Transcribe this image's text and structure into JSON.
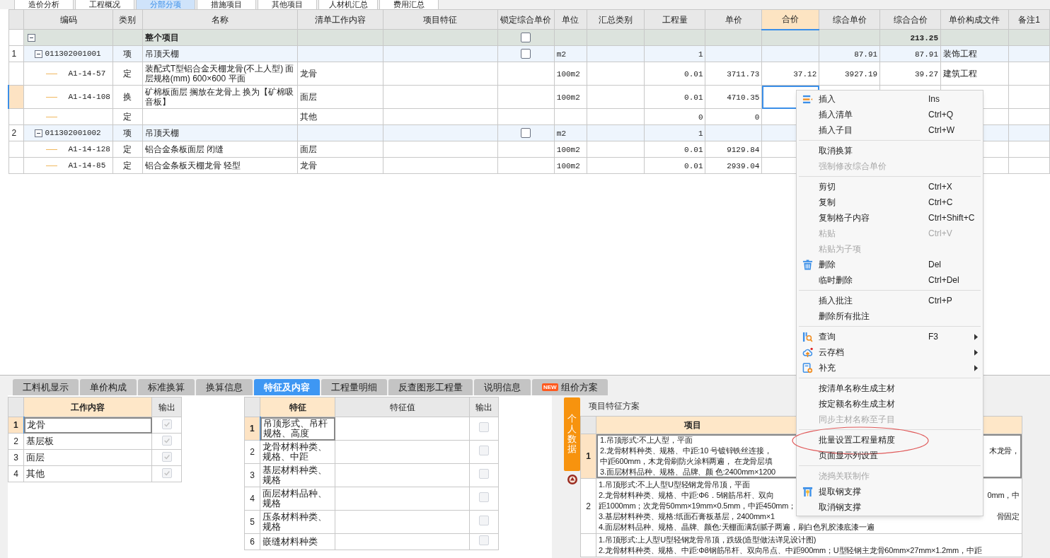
{
  "top_tabs": [
    {
      "label": "造价分析",
      "selected": false
    },
    {
      "label": "工程概况",
      "selected": false
    },
    {
      "label": "分部分项",
      "selected": true
    },
    {
      "label": "措施项目",
      "selected": false
    },
    {
      "label": "其他项目",
      "selected": false
    },
    {
      "label": "人材机汇总",
      "selected": false
    },
    {
      "label": "费用汇总",
      "selected": false
    }
  ],
  "main_table": {
    "columns": [
      {
        "label": "编码",
        "selected": false
      },
      {
        "label": "类别",
        "selected": false
      },
      {
        "label": "名称",
        "selected": false
      },
      {
        "label": "清单工作内容",
        "selected": false
      },
      {
        "label": "项目特征",
        "selected": false
      },
      {
        "label": "锁定综合单价",
        "selected": false
      },
      {
        "label": "单位",
        "selected": false
      },
      {
        "label": "汇总类别",
        "selected": false
      },
      {
        "label": "工程量",
        "selected": false
      },
      {
        "label": "单价",
        "selected": false
      },
      {
        "label": "合价",
        "selected": true
      },
      {
        "label": "综合单价",
        "selected": false
      },
      {
        "label": "综合合价",
        "selected": false
      },
      {
        "label": "单价构成文件",
        "selected": false
      },
      {
        "label": "备注1",
        "selected": false
      }
    ],
    "rows": [
      {
        "kind": "group",
        "name": "整个项目",
        "locked": false,
        "total": "213.25",
        "expanded": true,
        "selected": false,
        "children": [
          {
            "kind": "item",
            "num": "1",
            "code": "011302001001",
            "type": "项",
            "name": "吊顶天棚",
            "locked": false,
            "unit": "m2",
            "qty": "1",
            "unit_price": "87.91",
            "total": "87.91",
            "file": "装饰工程",
            "expanded": true,
            "selected": false,
            "children": [
              {
                "kind": "sub",
                "code": "A1-14-57",
                "type": "定",
                "name": "装配式T型铝合金天棚龙骨(不上人型) 面层规格(mm) 600×600 平面",
                "work": "龙骨",
                "unit": "100m2",
                "qty": "0.01",
                "price": "3711.73",
                "amount": "37.12",
                "unit_price": "3927.19",
                "total": "39.27",
                "file": "建筑工程",
                "selected": false
              },
              {
                "kind": "sub",
                "code": "A1-14-108",
                "type": "换",
                "name": "矿棉板面层 搁放在龙骨上  换为【矿棉吸音板】",
                "work": "面层",
                "unit": "100m2",
                "qty": "0.01",
                "price": "4710.35",
                "selected": true
              },
              {
                "kind": "sub",
                "type": "定",
                "work": "其他",
                "qty": "0",
                "price": "0",
                "selected": false
              }
            ]
          },
          {
            "kind": "item",
            "num": "2",
            "code": "011302001002",
            "type": "项",
            "name": "吊顶天棚",
            "locked": false,
            "unit": "m2",
            "qty": "1",
            "expanded": true,
            "selected": false,
            "children": [
              {
                "kind": "sub",
                "code": "A1-14-128",
                "type": "定",
                "name": "铝合金条板面层 闭缝",
                "work": "面层",
                "unit": "100m2",
                "qty": "0.01",
                "price": "9129.84",
                "selected": false
              },
              {
                "kind": "sub",
                "code": "A1-14-85",
                "type": "定",
                "name": "铝合金条板天棚龙骨 轻型",
                "work": "龙骨",
                "unit": "100m2",
                "qty": "0.01",
                "price": "2939.04",
                "selected": false
              }
            ]
          }
        ]
      }
    ]
  },
  "bottom_tabs": [
    {
      "label": "工料机显示",
      "selected": false
    },
    {
      "label": "单价构成",
      "selected": false
    },
    {
      "label": "标准换算",
      "selected": false
    },
    {
      "label": "换算信息",
      "selected": false
    },
    {
      "label": "特征及内容",
      "selected": true
    },
    {
      "label": "工程量明细",
      "selected": false
    },
    {
      "label": "反查图形工程量",
      "selected": false
    },
    {
      "label": "说明信息",
      "selected": false
    },
    {
      "label": "组价方案",
      "badge": "NEW",
      "selected": false
    }
  ],
  "work_table": {
    "columns": [
      "工作内容",
      "输出"
    ],
    "rows": [
      {
        "num": "1",
        "text": "龙骨",
        "checked": true,
        "selected": true
      },
      {
        "num": "2",
        "text": "基层板",
        "checked": true,
        "selected": false
      },
      {
        "num": "3",
        "text": "面层",
        "checked": true,
        "selected": false
      },
      {
        "num": "4",
        "text": "其他",
        "checked": true,
        "selected": false
      }
    ]
  },
  "feature_table": {
    "columns": [
      "特征",
      "特征值",
      "输出"
    ],
    "rows": [
      {
        "num": "1",
        "text": "吊顶形式、吊杆规格、高度",
        "checked": false,
        "selected": true
      },
      {
        "num": "2",
        "text": "龙骨材料种类、规格、中距",
        "checked": false,
        "selected": false
      },
      {
        "num": "3",
        "text": "基层材料种类、规格",
        "checked": false,
        "selected": false
      },
      {
        "num": "4",
        "text": "面层材料品种、规格",
        "checked": false,
        "selected": false
      },
      {
        "num": "5",
        "text": "压条材料种类、规格",
        "checked": false,
        "selected": false
      },
      {
        "num": "6",
        "text": "嵌缝材料种类",
        "checked": false,
        "selected": false
      }
    ]
  },
  "side_button": "个人数据",
  "scheme": {
    "title": "项目特征方案",
    "header": "项目",
    "rows": [
      {
        "num": "1",
        "selected": true,
        "lines": [
          {
            "left": "1.吊顶形式:不上人型，平面"
          },
          {
            "left": "2.龙骨材料种类、规格、中距:10 号镀锌铁丝连接，",
            "right": "木龙骨，"
          },
          {
            "left": "中距600mm，木龙骨刷防火涂料两遍， 在龙骨层填"
          },
          {
            "left": "3.面层材料品种、规格、品牌、颜 色:2400mm×1200"
          }
        ]
      },
      {
        "num": "2",
        "selected": false,
        "lines": [
          {
            "left": "1.吊顶形式:不上人型U型轻钢龙骨吊顶，平面"
          },
          {
            "left": "2.龙骨材料种类、规格、中距:Φ6．5钢筋吊杆、双向",
            "right": "0mm，中"
          },
          {
            "left": "距1000mm；次龙骨50mm×19mm×0.5mm，中距450mm；"
          },
          {
            "left": "3.基层材料种类、规格:纸面石膏板基层，2400mm×1",
            "right": "骨固定"
          },
          {
            "left": "4.面层材料品种、规格、晶牌、颜色:天棚面满刮腻子两遍，刷白色乳胶漆底漆一遍"
          }
        ]
      },
      {
        "selected": false,
        "lines": [
          {
            "left": "1.吊顶形式:上人型U型轻钢龙骨吊顶，跌级(造型做法详见设计图)"
          },
          {
            "left": "2.龙骨材料种类、规格、中距:Φ8钢筋吊杆、双向吊点、中距900mm；U型轻钢主龙骨60mm×27mm×1.2mm，中距"
          }
        ]
      }
    ]
  },
  "context_menu": [
    {
      "kind": "insert",
      "label": "插入",
      "shortcut": "Ins",
      "disabled": false
    },
    {
      "kind": "plain",
      "label": "插入清单",
      "shortcut": "Ctrl+Q",
      "disabled": false
    },
    {
      "kind": "plain",
      "label": "插入子目",
      "shortcut": "Ctrl+W",
      "disabled": false
    },
    {
      "kind": "separator"
    },
    {
      "kind": "plain",
      "label": "取消换算",
      "disabled": false
    },
    {
      "kind": "plain",
      "label": "强制修改综合单价",
      "disabled": true
    },
    {
      "kind": "separator"
    },
    {
      "kind": "plain",
      "label": "剪切",
      "shortcut": "Ctrl+X",
      "disabled": false
    },
    {
      "kind": "plain",
      "label": "复制",
      "shortcut": "Ctrl+C",
      "disabled": false
    },
    {
      "kind": "plain",
      "label": "复制格子内容",
      "shortcut": "Ctrl+Shift+C",
      "disabled": false
    },
    {
      "kind": "plain",
      "label": "粘贴",
      "shortcut": "Ctrl+V",
      "disabled": true
    },
    {
      "kind": "plain",
      "label": "粘贴为子项",
      "disabled": true
    },
    {
      "kind": "delete",
      "label": "删除",
      "shortcut": "Del",
      "disabled": false
    },
    {
      "kind": "plain",
      "label": "临时删除",
      "shortcut": "Ctrl+Del",
      "disabled": false
    },
    {
      "kind": "separator"
    },
    {
      "kind": "plain",
      "label": "插入批注",
      "shortcut": "Ctrl+P",
      "disabled": false
    },
    {
      "kind": "plain",
      "label": "删除所有批注",
      "disabled": false
    },
    {
      "kind": "separator"
    },
    {
      "kind": "query",
      "label": "查询",
      "shortcut": "F3",
      "submenu": true,
      "disabled": false
    },
    {
      "kind": "cloud",
      "label": "云存档",
      "submenu": true,
      "disabled": false
    },
    {
      "kind": "supplement",
      "label": "补充",
      "submenu": true,
      "disabled": false
    },
    {
      "kind": "separator"
    },
    {
      "kind": "plain",
      "label": "按清单名称生成主材",
      "disabled": false
    },
    {
      "kind": "plain",
      "label": "按定额名称生成主材",
      "disabled": false
    },
    {
      "kind": "plain",
      "label": "同步主材名称至子目",
      "disabled": true
    },
    {
      "kind": "separator"
    },
    {
      "kind": "plain",
      "label": "批量设置工程量精度",
      "disabled": false,
      "annotated": true
    },
    {
      "kind": "plain",
      "label": "页面显示列设置",
      "disabled": false
    },
    {
      "kind": "separator"
    },
    {
      "kind": "plain",
      "label": "浇捣关联制作",
      "disabled": true
    },
    {
      "kind": "support",
      "label": "提取钢支撑",
      "disabled": false
    },
    {
      "kind": "plain",
      "label": "取消钢支撑",
      "disabled": false
    }
  ]
}
